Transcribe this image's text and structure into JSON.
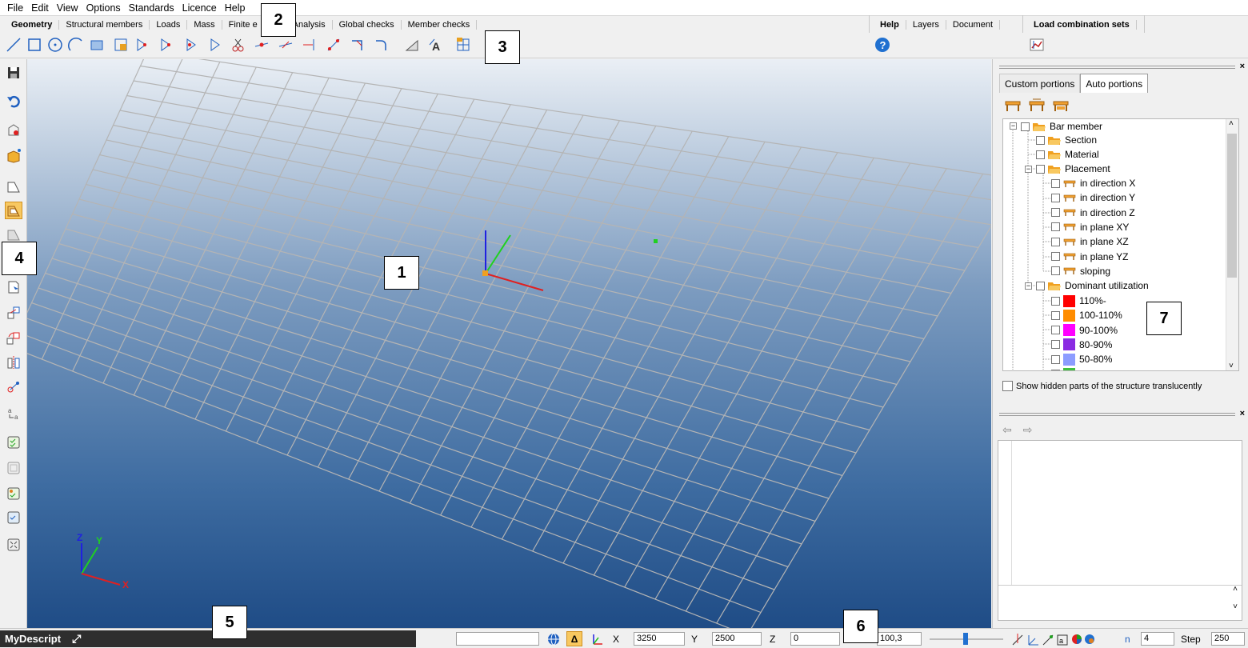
{
  "menu": [
    "File",
    "Edit",
    "View",
    "Options",
    "Standards",
    "Licence",
    "Help"
  ],
  "ribbon_tabs": [
    "Geometry",
    "Structural members",
    "Loads",
    "Mass",
    "Finite e",
    "Analysis",
    "Global checks",
    "Member checks"
  ],
  "right_tabs": [
    "Help",
    "Layers",
    "Document"
  ],
  "load_combination_label": "Load combination sets",
  "panel_tabs": [
    "Custom portions",
    "Auto portions"
  ],
  "tree": {
    "root": "Bar member",
    "section": "Section",
    "material": "Material",
    "placement": "Placement",
    "placement_items": [
      "in direction X",
      "in direction Y",
      "in direction Z",
      "in plane XY",
      "in plane XZ",
      "in plane YZ",
      "sloping"
    ],
    "dominant": "Dominant utilization",
    "utilization": [
      {
        "label": "110%-",
        "color": "#ff0000"
      },
      {
        "label": "100-110%",
        "color": "#ff8c00"
      },
      {
        "label": "90-100%",
        "color": "#ff00ff"
      },
      {
        "label": "80-90%",
        "color": "#8a2be2"
      },
      {
        "label": "50-80%",
        "color": "#8c9cff"
      }
    ]
  },
  "show_hidden_label": "Show hidden parts of the structure translucently",
  "axis_labels": {
    "x": "X",
    "y": "Y",
    "z": "Z"
  },
  "status": {
    "project": "MyDescript",
    "x_label": "X",
    "x_value": "3250",
    "y_label": "Y",
    "y_value": "2500",
    "z_label": "Z",
    "z_value": "0",
    "zoom_value": "100,3",
    "n_label": "n",
    "n_value": "4",
    "step_label": "Step",
    "step_value": "250"
  },
  "callouts": [
    "1",
    "2",
    "3",
    "4",
    "5",
    "6",
    "7"
  ],
  "colors": {
    "axis_x": "#e02020",
    "axis_y": "#20c020",
    "axis_z": "#2020e0",
    "origin": "#f0a020",
    "accent": "#f8c860"
  }
}
